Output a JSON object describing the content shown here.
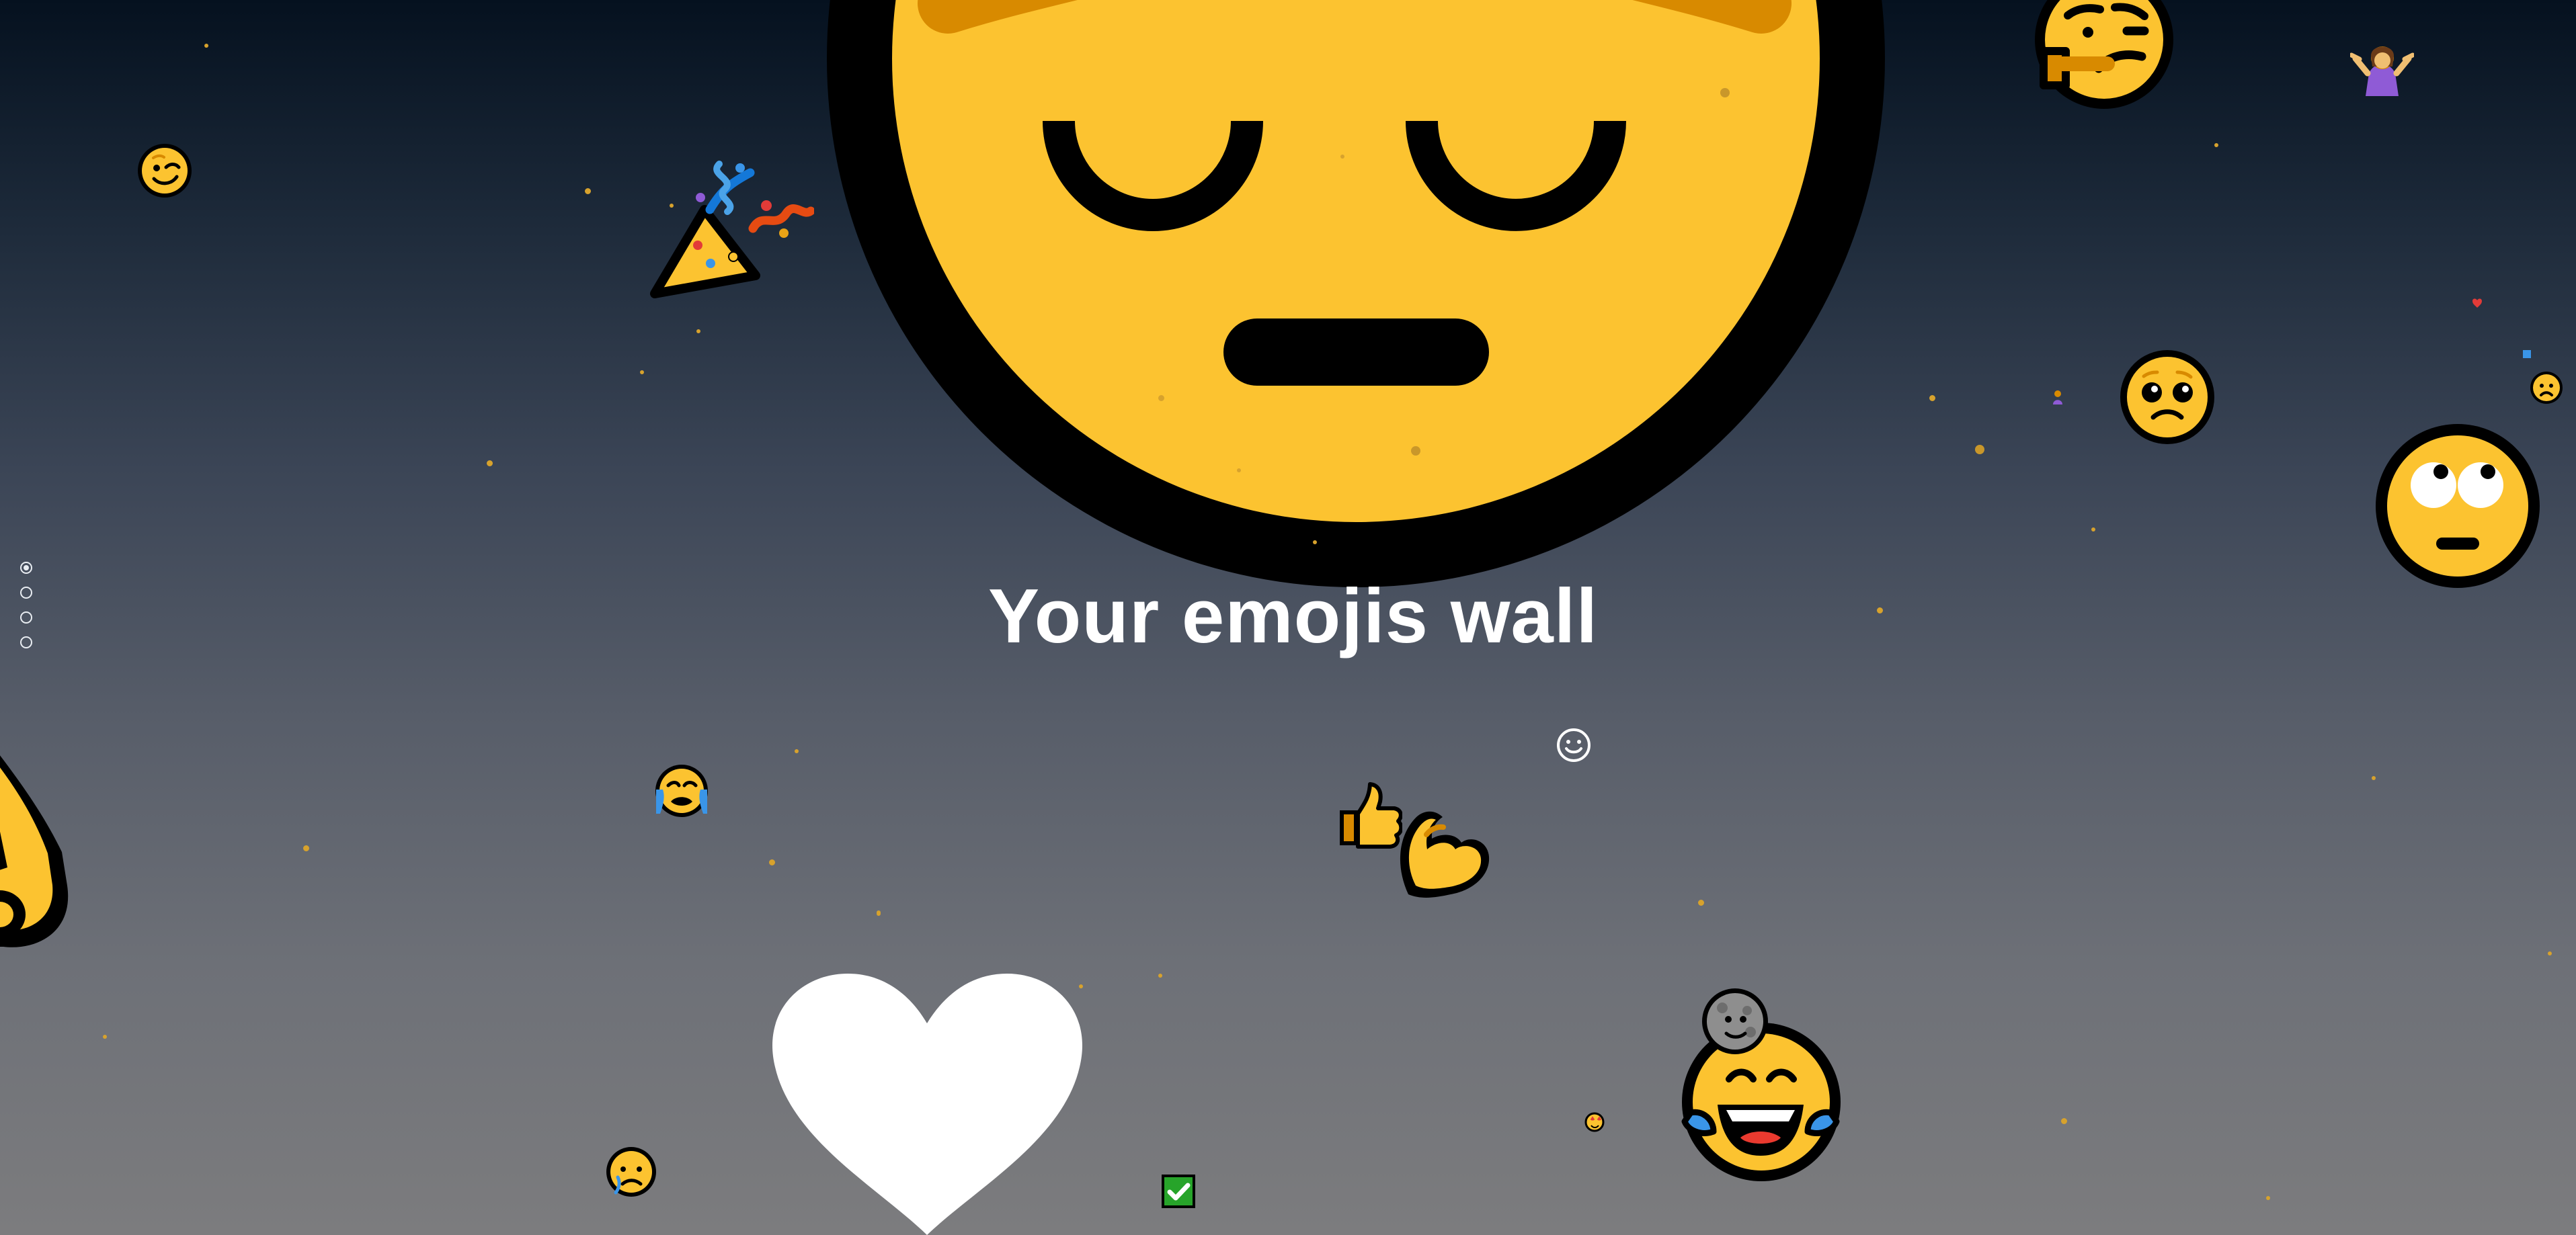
{
  "page": {
    "title": "Your emojis wall"
  },
  "navigation": {
    "dots": [
      "slide 1",
      "slide 2",
      "slide 3",
      "slide 4"
    ],
    "active_index": 0
  },
  "floating_emojis": [
    {
      "name": "pensive-face",
      "icon": "pensive-face-icon"
    },
    {
      "name": "party-popper",
      "icon": "party-popper-icon"
    },
    {
      "name": "thinking-face",
      "icon": "thinking-face-icon"
    },
    {
      "name": "person-shrugging",
      "icon": "person-shrugging-icon"
    },
    {
      "name": "winking-face",
      "icon": "winking-face-icon"
    },
    {
      "name": "pleading-face",
      "icon": "pleading-face-icon"
    },
    {
      "name": "eye-roll-face",
      "icon": "face-with-rolling-eyes-icon"
    },
    {
      "name": "ok-hand",
      "icon": "ok-hand-icon"
    },
    {
      "name": "crying-face",
      "icon": "loudly-crying-face-icon"
    },
    {
      "name": "thumbs-up",
      "icon": "thumbs-up-icon"
    },
    {
      "name": "flexed-biceps",
      "icon": "flexed-biceps-icon"
    },
    {
      "name": "white-heart",
      "icon": "white-heart-icon"
    },
    {
      "name": "check-mark",
      "icon": "check-mark-button-icon"
    },
    {
      "name": "laughing-face",
      "icon": "face-with-tears-of-joy-icon"
    },
    {
      "name": "moon-face",
      "icon": "new-moon-face-icon"
    },
    {
      "name": "sad-face",
      "icon": "sad-but-relieved-face-icon"
    }
  ],
  "colors": {
    "emoji_yellow": "#fcc330",
    "emoji_orange": "#d88a00",
    "outline": "#000000",
    "heart": "#ffffff",
    "check_green": "#27a42a",
    "background_top": "#05111f",
    "background_bottom": "#7c7c7e"
  }
}
